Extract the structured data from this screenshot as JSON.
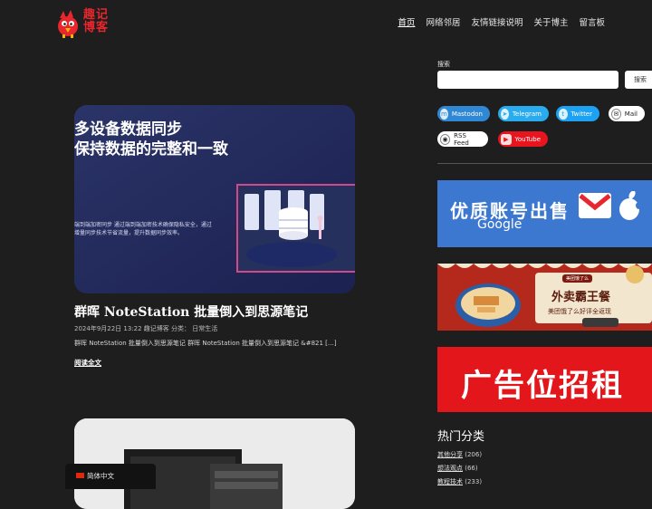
{
  "logo": {
    "line1": "趣记",
    "line2": "博客"
  },
  "nav": [
    {
      "label": "首页",
      "active": true
    },
    {
      "label": "网络邻居"
    },
    {
      "label": "友情链接说明"
    },
    {
      "label": "关于博主"
    },
    {
      "label": "留言板"
    }
  ],
  "post": {
    "image_heading_1": "多设备数据同步",
    "image_heading_2": "保持数据的完整和一致",
    "image_caption_1": "端到端加密同步 通过端到端加密技术确保隐私安全，通过",
    "image_caption_2": "增量同步技术节省流量，提升数据同步效率。",
    "title": "群晖 NoteStation 批量倒入到思源笔记",
    "meta": "2024年9月22日 13:22  趣记博客  分类：  日常生活",
    "excerpt": "群晖 NoteStation 批量倒入到思源笔记 群晖 NoteStation 批量倒入到思源笔记 &#821 […]",
    "read_more": "阅读全文"
  },
  "language": {
    "label": "简体中文"
  },
  "search": {
    "label": "搜索",
    "button": "搜索",
    "placeholder": ""
  },
  "social": [
    {
      "label": "Mastodon",
      "icon": "mastodon-icon"
    },
    {
      "label": "Telegram",
      "icon": "telegram-icon"
    },
    {
      "label": "Twitter",
      "icon": "twitter-icon"
    },
    {
      "label": "Mail",
      "icon": "mail-icon"
    },
    {
      "label": "RSS Feed",
      "icon": "rss-icon"
    },
    {
      "label": "YouTube",
      "icon": "youtube-icon"
    }
  ],
  "ads": {
    "ad1_title": "优质账号出售",
    "ad1_sub": "Google",
    "ad2_tag": "美团饿了么",
    "ad2_title": "外卖霸王餐",
    "ad2_sub": "美团饿了么好评全返现",
    "ad3_title": "广告位招租"
  },
  "categories": {
    "title": "热门分类",
    "items": [
      {
        "name": "其他分享",
        "count": "(206)"
      },
      {
        "name": "想法观点",
        "count": "(66)"
      },
      {
        "name": "教程技术",
        "count": "(233)"
      }
    ]
  },
  "colors": {
    "accent": "#e8262d",
    "background": "#1e1e1e"
  }
}
